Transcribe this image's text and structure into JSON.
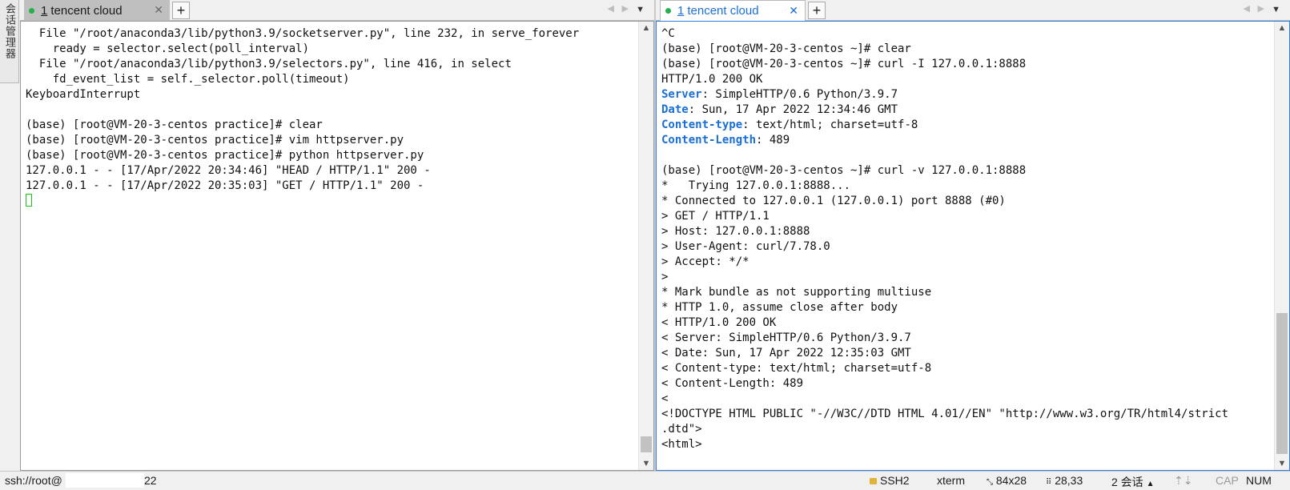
{
  "session_manager": {
    "label": "会话管理器"
  },
  "left_pane": {
    "tab": {
      "number": "1",
      "title": "tencent cloud",
      "close": "✕"
    },
    "lines": [
      "  File \"/root/anaconda3/lib/python3.9/socketserver.py\", line 232, in serve_forever",
      "    ready = selector.select(poll_interval)",
      "  File \"/root/anaconda3/lib/python3.9/selectors.py\", line 416, in select",
      "    fd_event_list = self._selector.poll(timeout)",
      "KeyboardInterrupt",
      "",
      "(base) [root@VM-20-3-centos practice]# clear",
      "(base) [root@VM-20-3-centos practice]# vim httpserver.py",
      "(base) [root@VM-20-3-centos practice]# python httpserver.py",
      "127.0.0.1 - - [17/Apr/2022 20:34:46] \"HEAD / HTTP/1.1\" 200 -",
      "127.0.0.1 - - [17/Apr/2022 20:35:03] \"GET / HTTP/1.1\" 200 -"
    ]
  },
  "right_pane": {
    "tab": {
      "number": "1",
      "title": "tencent cloud",
      "close": "✕"
    },
    "lines": [
      "^C",
      "(base) [root@VM-20-3-centos ~]# clear",
      "(base) [root@VM-20-3-centos ~]# curl -I 127.0.0.1:8888",
      "HTTP/1.0 200 OK",
      {
        "name": "Server",
        "value": ": SimpleHTTP/0.6 Python/3.9.7"
      },
      {
        "name": "Date",
        "value": ": Sun, 17 Apr 2022 12:34:46 GMT"
      },
      {
        "name": "Content-type",
        "value": ": text/html; charset=utf-8"
      },
      {
        "name": "Content-Length",
        "value": ": 489"
      },
      "",
      "(base) [root@VM-20-3-centos ~]# curl -v 127.0.0.1:8888",
      "*   Trying 127.0.0.1:8888...",
      "* Connected to 127.0.0.1 (127.0.0.1) port 8888 (#0)",
      "> GET / HTTP/1.1",
      "> Host: 127.0.0.1:8888",
      "> User-Agent: curl/7.78.0",
      "> Accept: */*",
      ">",
      "* Mark bundle as not supporting multiuse",
      "* HTTP 1.0, assume close after body",
      "< HTTP/1.0 200 OK",
      "< Server: SimpleHTTP/0.6 Python/3.9.7",
      "< Date: Sun, 17 Apr 2022 12:35:03 GMT",
      "< Content-type: text/html; charset=utf-8",
      "< Content-Length: 489",
      "<",
      "<!DOCTYPE HTML PUBLIC \"-//W3C//DTD HTML 4.01//EN\" \"http://www.w3.org/TR/html4/strict",
      ".dtd\">",
      "<html>"
    ]
  },
  "statusbar": {
    "connection_prefix": "ssh://root@",
    "port": "22",
    "protocol": "SSH2",
    "terminal_type": "xterm",
    "size": "84x28",
    "cursor_pos": "28,33",
    "sessions": "2 会话",
    "caps": "CAP",
    "num": "NUM"
  },
  "icons": {
    "tab_status": "green-dot-icon",
    "protocol": "lock-icon",
    "size": "terminal-size-icon",
    "cursor": "cursor-position-icon"
  },
  "colors": {
    "header_name": "#1a6fd6",
    "active_tab_text": "#1a6fd6",
    "status_dot": "#23b14d",
    "cursor": "#15c515"
  }
}
